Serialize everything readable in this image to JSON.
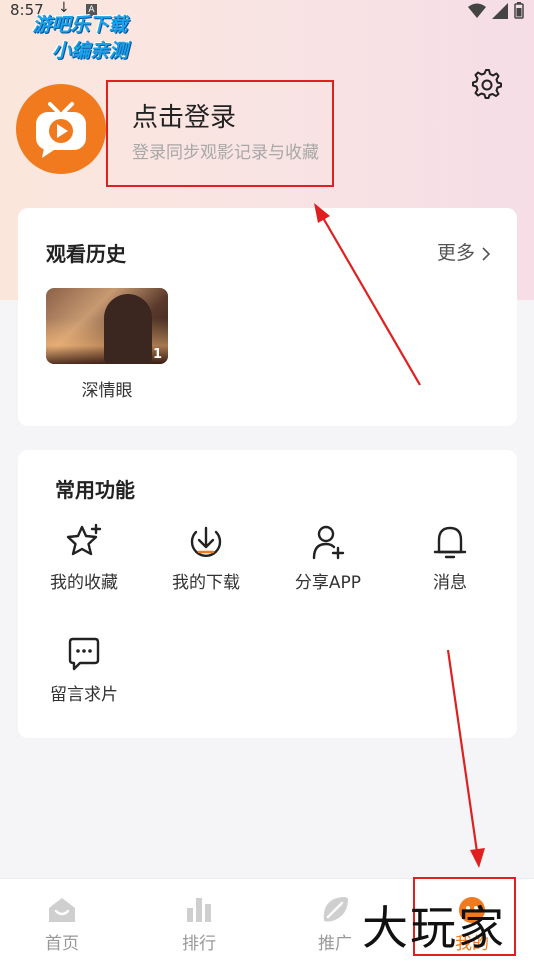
{
  "status_bar": {
    "time": "8:57",
    "download_glyph": "↓",
    "notif_glyph": "A"
  },
  "watermark_top": {
    "line1": "游吧乐下载",
    "line2": "小编亲测"
  },
  "profile": {
    "login_title": "点击登录",
    "login_subtitle": "登录同步观影记录与收藏"
  },
  "history": {
    "title": "观看历史",
    "more_label": "更多",
    "items": [
      {
        "title": "深情眼",
        "episode": "1"
      }
    ]
  },
  "functions": {
    "title": "常用功能",
    "items": [
      {
        "label": "我的收藏",
        "icon": "star-icon"
      },
      {
        "label": "我的下载",
        "icon": "download-icon"
      },
      {
        "label": "分享APP",
        "icon": "share-user-icon"
      },
      {
        "label": "消息",
        "icon": "bell-icon"
      },
      {
        "label": "留言求片",
        "icon": "message-icon"
      }
    ]
  },
  "tabbar": {
    "items": [
      {
        "label": "首页",
        "icon": "home-icon"
      },
      {
        "label": "排行",
        "icon": "ranking-icon"
      },
      {
        "label": "推广",
        "icon": "promote-icon"
      },
      {
        "label": "我的",
        "icon": "profile-icon",
        "active": true
      }
    ]
  },
  "watermark_bottom": "大玩家",
  "colors": {
    "accent": "#f07a1d",
    "annotation": "#e02020",
    "watermark_blue": "#1aa3e8"
  }
}
